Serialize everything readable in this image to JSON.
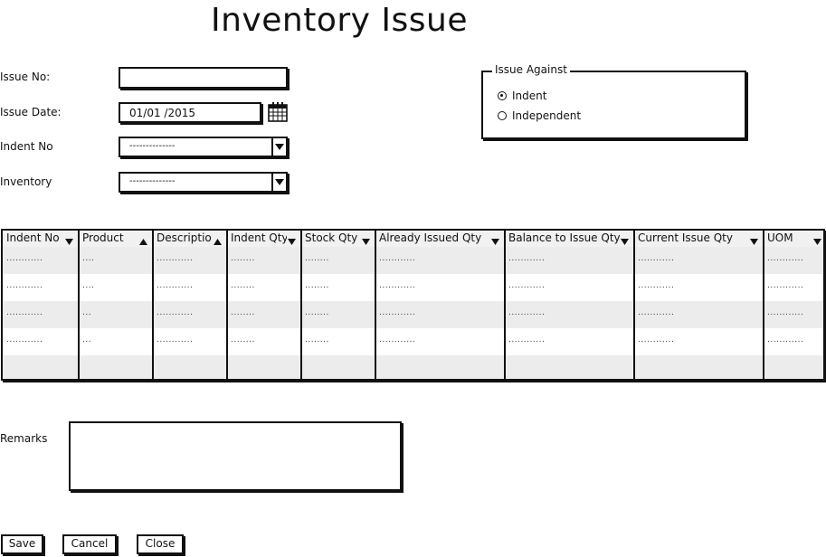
{
  "page": {
    "title": "Inventory Issue"
  },
  "form": {
    "issue_no_label": "Issue No:",
    "issue_no_value": "",
    "issue_date_label": "Issue Date:",
    "issue_date_value": "01/01  /2015",
    "indent_no_label": "Indent No",
    "indent_no_value": "--------------",
    "inventory_label": "Inventory",
    "inventory_value": "--------------",
    "calendar_icon": "calendar-icon",
    "dropdown_icon": "chevron-down-icon"
  },
  "issue_against": {
    "legend": "Issue Against",
    "options": [
      {
        "label": "Indent",
        "selected": true
      },
      {
        "label": "Independent",
        "selected": false
      }
    ]
  },
  "grid": {
    "columns": [
      {
        "label": "Indent No",
        "sort": "down"
      },
      {
        "label": "Product",
        "sort": "up"
      },
      {
        "label": "Descriptio",
        "sort": "up"
      },
      {
        "label": "Indent Qty",
        "sort": "down"
      },
      {
        "label": "Stock Qty",
        "sort": "down"
      },
      {
        "label": "Already Issued Qty",
        "sort": "down"
      },
      {
        "label": "Balance to Issue Qty",
        "sort": "down"
      },
      {
        "label": "Current Issue Qty",
        "sort": "down"
      },
      {
        "label": "UOM",
        "sort": "down"
      }
    ],
    "rows": [
      [
        "............",
        "....",
        "............",
        "........",
        "........",
        "............",
        "............",
        "............",
        "............"
      ],
      [
        "............",
        "....",
        "............",
        "........",
        "........",
        "............",
        "............",
        "............",
        "............"
      ],
      [
        "............",
        "...",
        "............",
        "........",
        "........",
        "............",
        "............",
        "............",
        "............"
      ],
      [
        "............",
        "...",
        "............",
        "........",
        "........",
        "............",
        "............",
        "............",
        "............"
      ],
      [
        "",
        "",
        "",
        "",
        "",
        "",
        "",
        "",
        ""
      ]
    ]
  },
  "remarks": {
    "label": "Remarks",
    "value": ""
  },
  "actions": {
    "save": "Save",
    "cancel": "Cancel",
    "close": "Close"
  }
}
